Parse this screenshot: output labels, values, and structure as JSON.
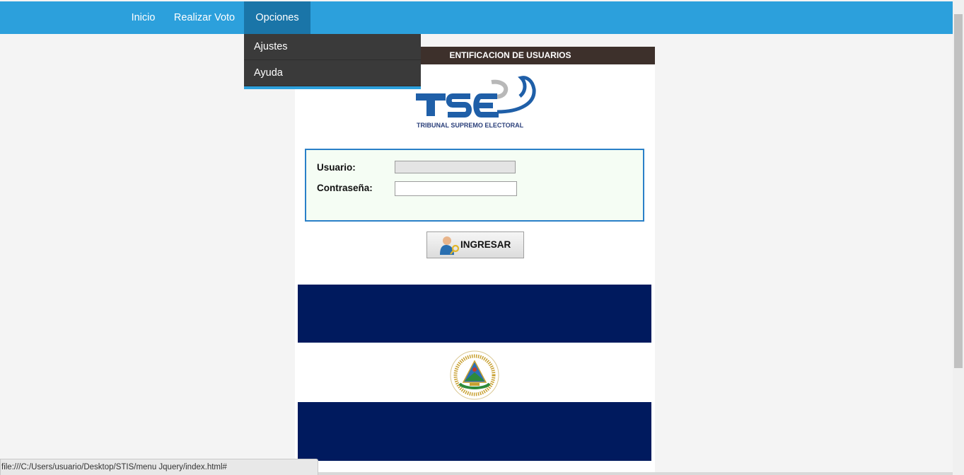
{
  "nav": {
    "items": [
      {
        "label": "Inicio"
      },
      {
        "label": "Realizar Voto"
      },
      {
        "label": "Opciones"
      }
    ],
    "dropdown": [
      {
        "label": "Ajustes"
      },
      {
        "label": "Ayuda"
      }
    ]
  },
  "panel": {
    "header_title": "ENTIFICACION DE USUARIOS",
    "logo_text": "TSE",
    "logo_subtitle": "TRIBUNAL SUPREMO ELECTORAL"
  },
  "form": {
    "user_label": "Usuario:",
    "password_label": "Contraseña:",
    "user_value": "",
    "password_value": "",
    "submit_label": "INGRESAR"
  },
  "flag": {
    "seal_text": "REPUBLICA DE EL SALVADOR EN LA AMERICA CENTRAL"
  },
  "status": {
    "url": "file:///C:/Users/usuario/Desktop/STIS/menu Jquery/index.html#"
  },
  "colors": {
    "nav": "#2ca0dc",
    "nav_active": "#1a75a8",
    "flag_blue": "#001a5e",
    "header_bar": "#3d302b"
  }
}
